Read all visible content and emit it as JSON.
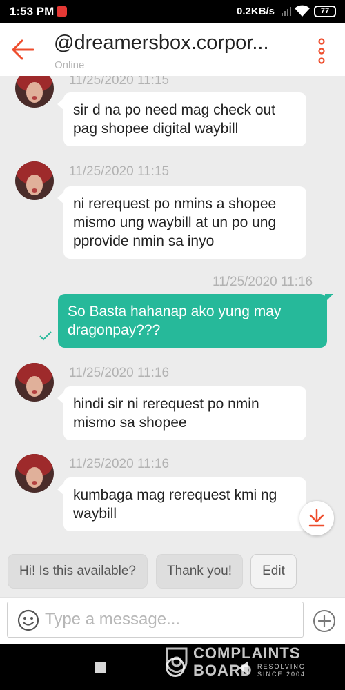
{
  "status_bar": {
    "time": "1:53 PM",
    "network_speed": "0.2KB/s",
    "battery": "77"
  },
  "header": {
    "title": "@dreamersbox.corpor...",
    "status": "Online"
  },
  "messages": [
    {
      "direction": "incoming",
      "timestamp": "11/25/2020 11:15",
      "text": "sir d na po need mag check out pag shopee digital waybill"
    },
    {
      "direction": "incoming",
      "timestamp": "11/25/2020 11:15",
      "text": "ni rerequest po nmins a shopee mismo ung waybill at un po ung pprovide nmin sa inyo"
    },
    {
      "direction": "outgoing",
      "timestamp": "11/25/2020 11:16",
      "text": "So Basta hahanap ako yung may dragonpay???"
    },
    {
      "direction": "incoming",
      "timestamp": "11/25/2020 11:16",
      "text": "hindi sir ni rerequest po nmin mismo sa shopee"
    },
    {
      "direction": "incoming",
      "timestamp": "11/25/2020 11:16",
      "text": "kumbaga mag rerequest kmi ng waybill"
    }
  ],
  "quick_replies": [
    "Hi! Is this available?",
    "Thank you!",
    "Edit"
  ],
  "composer": {
    "placeholder": "Type a message..."
  },
  "watermark": {
    "line1": "COMPLAINTS",
    "line2": "BOARD",
    "line3a": "RESOLVING",
    "line3b": "SINCE 2004"
  },
  "colors": {
    "accent": "#ee4d2d",
    "outgoing_bubble": "#26b99a",
    "chat_background": "#ececec"
  },
  "icons": {
    "back": "arrow-left-icon",
    "more": "more-vertical-icon",
    "delivered": "check-icon",
    "download": "download-icon",
    "emoji": "smiley-icon",
    "add": "plus-circle-icon"
  }
}
